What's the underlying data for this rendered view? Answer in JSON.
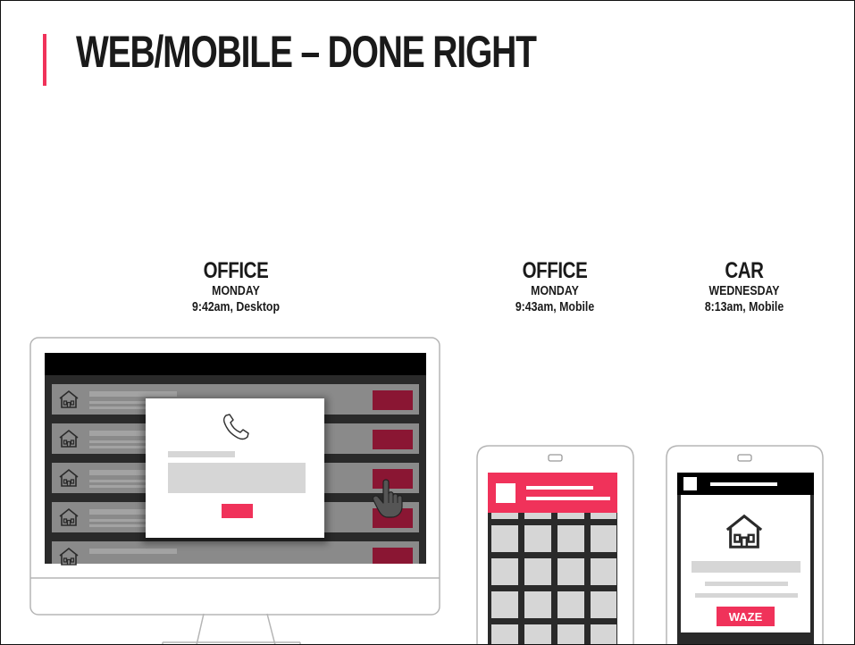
{
  "slide": {
    "title": "WEB/MOBILE – DONE RIGHT",
    "accent_color": "#f0325a"
  },
  "scenes": [
    {
      "place": "OFFICE",
      "day": "MONDAY",
      "time": "9:42am, Desktop"
    },
    {
      "place": "OFFICE",
      "day": "MONDAY",
      "time": "9:43am, Mobile"
    },
    {
      "place": "CAR",
      "day": "WEDNESDAY",
      "time": "8:13am, Mobile"
    }
  ],
  "desktop": {
    "row_icon": "house-icon",
    "modal_icon": "phone-icon",
    "cursor_icon": "hand-pointer-icon"
  },
  "car_phone": {
    "icon": "house-icon",
    "button_label": "WAZE"
  }
}
